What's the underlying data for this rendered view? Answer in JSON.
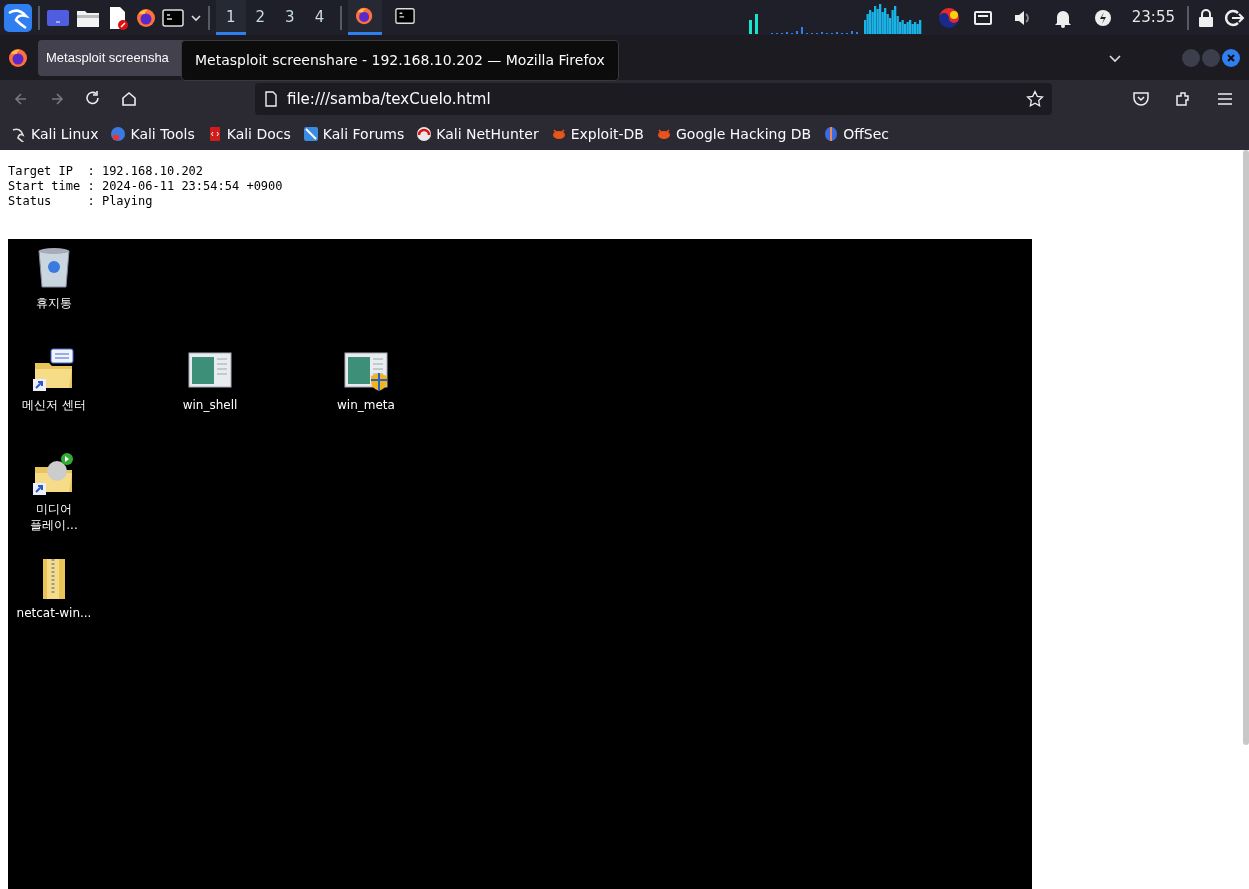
{
  "panel": {
    "workspaces": [
      {
        "label": "1",
        "selected": true
      },
      {
        "label": "2",
        "selected": false
      },
      {
        "label": "3",
        "selected": false
      },
      {
        "label": "4",
        "selected": false
      }
    ],
    "tasks": [
      {
        "kind": "firefox",
        "selected": true
      },
      {
        "kind": "terminal",
        "selected": false
      }
    ],
    "clock": "23:55"
  },
  "browser": {
    "tab": {
      "title": "Metasploit screensha"
    },
    "tooltip": "Metasploit screenshare - 192.168.10.202 — Mozilla Firefox",
    "url": "file:///samba/texCueIo.html",
    "bookmarks": [
      {
        "label": "Kali Linux",
        "kind": "dragon"
      },
      {
        "label": "Kali Tools",
        "kind": "tools"
      },
      {
        "label": "Kali Docs",
        "kind": "docs"
      },
      {
        "label": "Kali Forums",
        "kind": "forums"
      },
      {
        "label": "Kali NetHunter",
        "kind": "nethunter"
      },
      {
        "label": "Exploit-DB",
        "kind": "bug"
      },
      {
        "label": "Google Hacking DB",
        "kind": "bug"
      },
      {
        "label": "OffSec",
        "kind": "offsec"
      }
    ]
  },
  "page": {
    "info_lines": [
      "Target IP  : 192.168.10.202",
      "Start time : 2024-06-11 23:54:54 +0900",
      "Status     : Playing"
    ],
    "remote_desktop": {
      "icons": [
        {
          "kind": "recycle-bin",
          "label_lines": [
            "휴지통"
          ]
        },
        {
          "kind": "folder-shortcut",
          "label_lines": [
            "메신저 센터"
          ]
        },
        {
          "kind": "program",
          "label_lines": [
            "win_shell"
          ]
        },
        {
          "kind": "program-shield",
          "label_lines": [
            "win_meta"
          ]
        },
        {
          "kind": "media-shortcut",
          "label_lines": [
            "미디어",
            "플레이..."
          ]
        },
        {
          "kind": "zip-folder",
          "label_lines": [
            "netcat-win..."
          ]
        }
      ]
    }
  }
}
